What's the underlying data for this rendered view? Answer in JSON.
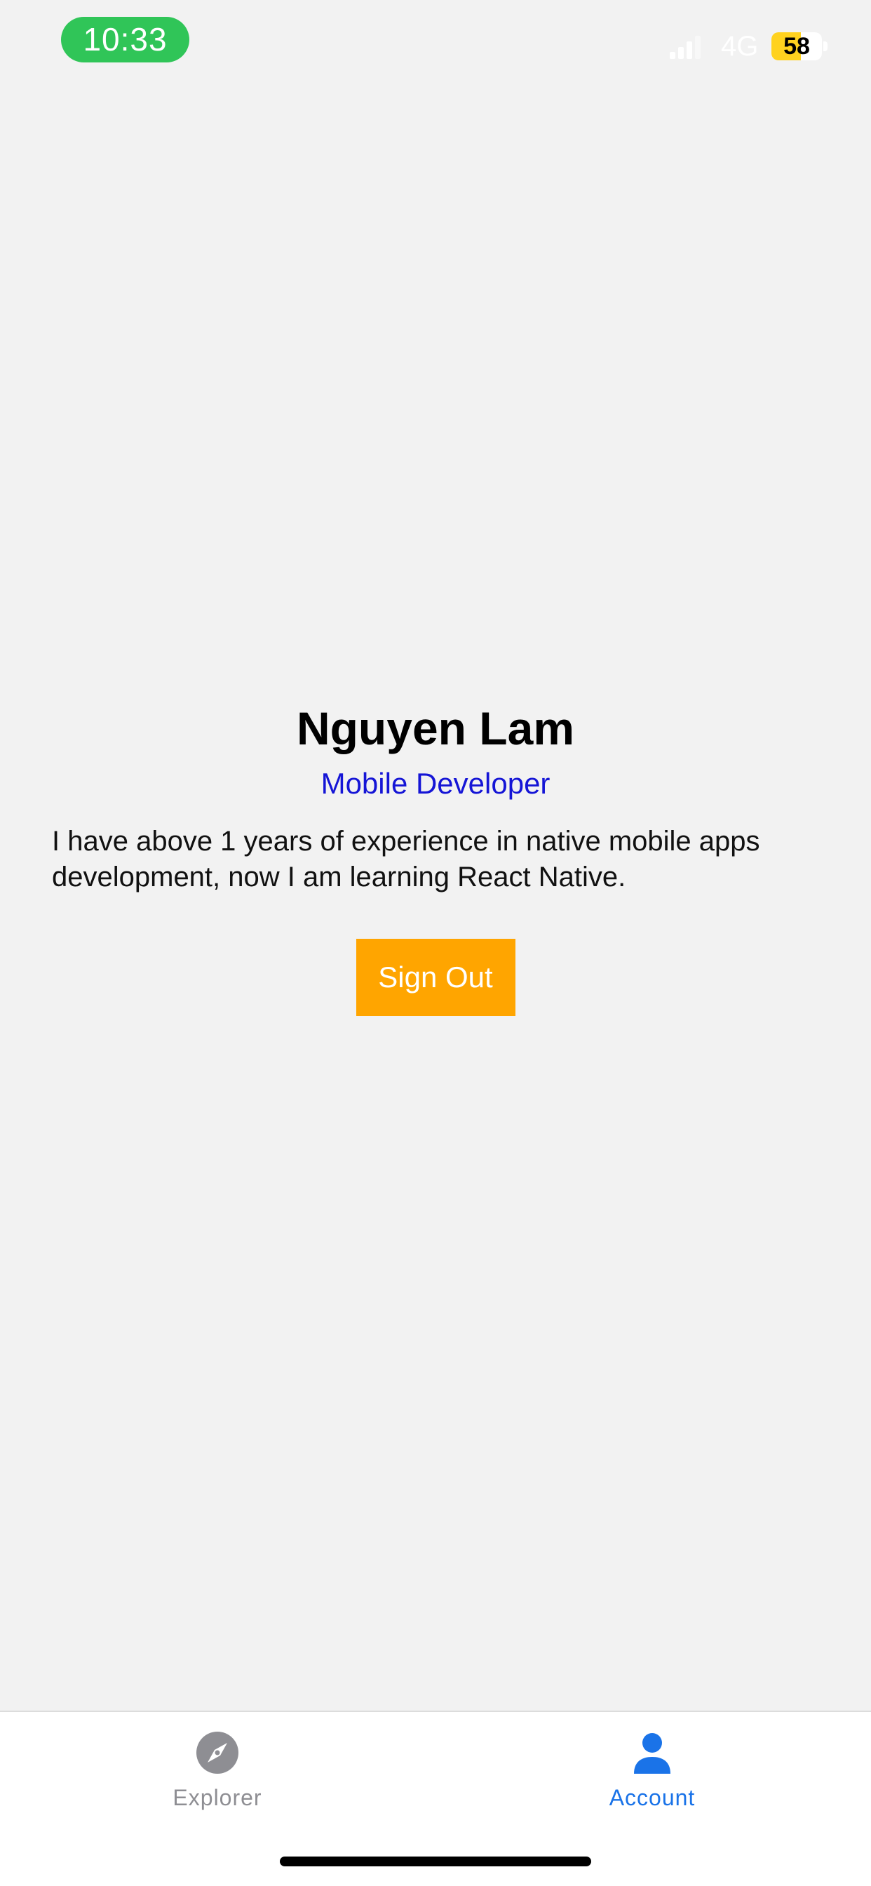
{
  "status_bar": {
    "time": "10:33",
    "network": "4G",
    "battery_level": "58",
    "battery_fraction": 0.58,
    "time_pill_color": "#30c558",
    "battery_color": "#ffd21f",
    "signal_icon": "cellular-signal-icon"
  },
  "profile": {
    "name": "Nguyen Lam",
    "role": "Mobile Developer",
    "bio": "I have above 1 years of experience in native mobile apps development, now I am learning React Native.",
    "role_color": "#1515d6"
  },
  "actions": {
    "sign_out_label": "Sign Out",
    "sign_out_color": "#ffa500"
  },
  "tab_bar": {
    "tabs": [
      {
        "label": "Explorer",
        "icon": "compass-icon",
        "active": false
      },
      {
        "label": "Account",
        "icon": "person-icon",
        "active": true
      }
    ],
    "active_color": "#1a73e8",
    "inactive_color": "#8e8e93"
  }
}
